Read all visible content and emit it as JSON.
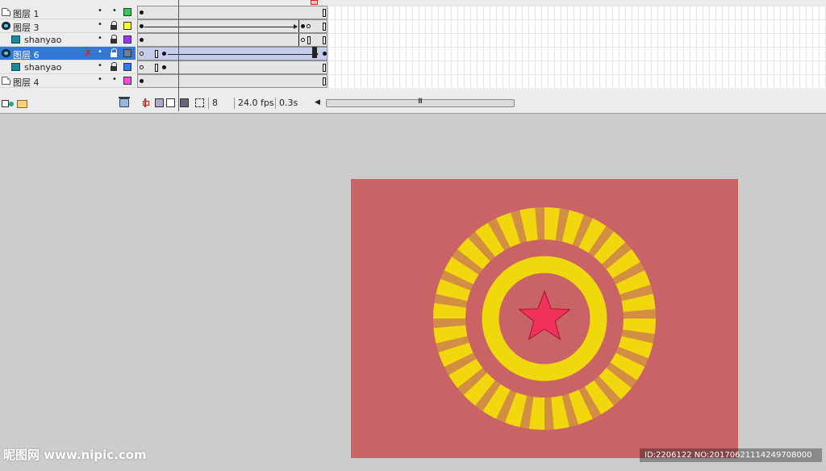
{
  "layers": [
    {
      "name": "图层 1",
      "type": "normal",
      "swatch": "#33cc55",
      "locked": false,
      "selected": false
    },
    {
      "name": "图层 3",
      "type": "mask",
      "swatch": "#ffff33",
      "locked": true,
      "selected": false
    },
    {
      "name": "shanyao",
      "type": "masked",
      "swatch": "#9933ff",
      "locked": true,
      "selected": false
    },
    {
      "name": "图层 6",
      "type": "mask",
      "swatch": "#6b7d99",
      "locked": true,
      "selected": true
    },
    {
      "name": "shanyao",
      "type": "masked",
      "swatch": "#3377ff",
      "locked": true,
      "selected": false
    },
    {
      "name": "图层 4",
      "type": "normal",
      "swatch": "#ff44dd",
      "locked": false,
      "selected": false
    }
  ],
  "status": {
    "current_frame": "8",
    "fps": "24.0 fps",
    "elapsed": "0.3s",
    "scroll_grip": "III"
  },
  "icons": {
    "layer_tools": [
      "insert-layer-icon",
      "add-motion-guide-icon",
      "insert-folder-icon"
    ],
    "delete": "trash-icon",
    "status_tools": [
      "center-frame-icon",
      "onion-skin-icon",
      "onion-skin-outlines-icon",
      "edit-multiple-frames-icon",
      "modify-onion-markers-icon"
    ]
  },
  "stage": {
    "background": "#c96365",
    "canvas_background": "#cccccc",
    "ring_color": "#f2d60e",
    "star_color": "#f0325a"
  },
  "watermark": {
    "logo": "昵图网 www.nipic.com",
    "id_text": "ID:2206122 NO:20170621114249708000"
  }
}
